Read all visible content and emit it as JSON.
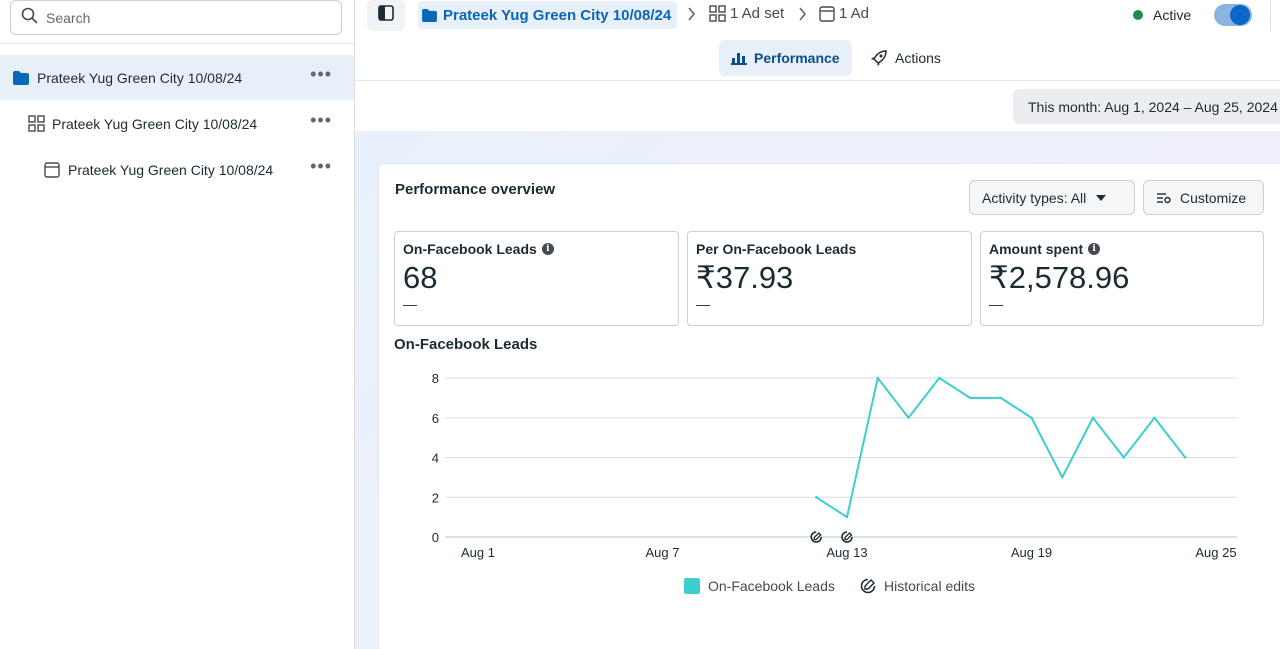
{
  "search": {
    "placeholder": "Search"
  },
  "sidebar": {
    "items": [
      {
        "label": "Prateek Yug Green City 10/08/24",
        "icon": "folder-icon"
      },
      {
        "label": "Prateek Yug Green City 10/08/24",
        "icon": "grid-icon"
      },
      {
        "label": "Prateek Yug Green City 10/08/24",
        "icon": "ad-window-icon"
      }
    ]
  },
  "breadcrumb": {
    "campaign": "Prateek Yug Green City 10/08/24",
    "adset": "1 Ad set",
    "ad": "1 Ad"
  },
  "status": {
    "label": "Active",
    "color": "#1f8a4c"
  },
  "tabs": {
    "performance": "Performance",
    "actions": "Actions"
  },
  "date_range": "This month: Aug 1, 2024 – Aug 25, 2024",
  "overview": {
    "title": "Performance overview",
    "activity_types": "Activity types: All",
    "customize": "Customize"
  },
  "metrics": [
    {
      "label": "On-Facebook Leads",
      "value": "68",
      "delta": "—",
      "info": true
    },
    {
      "label": "Per On-Facebook Leads",
      "value": "₹37.93",
      "delta": "—",
      "info": false
    },
    {
      "label": "Amount spent",
      "value": "₹2,578.96",
      "delta": "—",
      "info": true
    }
  ],
  "chart_title": "On-Facebook Leads",
  "chart_data": {
    "type": "line",
    "x_ticks": [
      "Aug 1",
      "Aug 7",
      "Aug 13",
      "Aug 19",
      "Aug 25"
    ],
    "y_ticks": [
      0,
      2,
      4,
      6,
      8
    ],
    "ylim": [
      0,
      8
    ],
    "xlim": [
      1,
      25
    ],
    "series": [
      {
        "name": "On-Facebook Leads",
        "color": "#3ccfcf",
        "x": [
          12,
          13,
          14,
          15,
          16,
          17,
          18,
          19,
          20,
          21,
          22,
          23,
          24
        ],
        "y": [
          2,
          1,
          8,
          6,
          8,
          7,
          7,
          6,
          3,
          6,
          4,
          6,
          4
        ]
      }
    ],
    "historical_edits_x": [
      12,
      13
    ],
    "legend": [
      "On-Facebook Leads",
      "Historical edits"
    ],
    "grid": true
  }
}
